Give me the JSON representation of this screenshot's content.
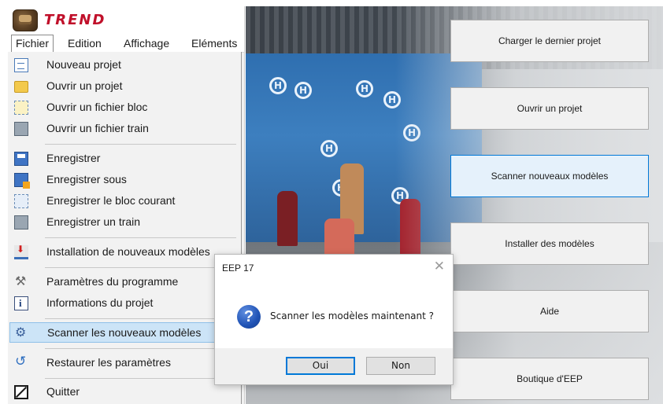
{
  "app": {
    "logo_text": "TREND"
  },
  "menubar": [
    "Fichier",
    "Edition",
    "Affichage",
    "Eléments"
  ],
  "menu": {
    "items": [
      {
        "label": "Nouveau projet",
        "icon": "new-document-icon"
      },
      {
        "label": "Ouvrir un projet",
        "icon": "folder-icon"
      },
      {
        "label": "Ouvrir un fichier bloc",
        "icon": "block-file-icon"
      },
      {
        "label": "Ouvrir un fichier train",
        "icon": "train-file-icon"
      },
      {
        "label": "Enregistrer",
        "icon": "save-icon"
      },
      {
        "label": "Enregistrer sous",
        "icon": "save-as-icon"
      },
      {
        "label": "Enregistrer le bloc courant",
        "icon": "save-block-icon"
      },
      {
        "label": "Enregistrer un train",
        "icon": "save-train-icon"
      },
      {
        "label": "Installation de nouveaux modèles",
        "icon": "install-icon"
      },
      {
        "label": "Paramètres du programme",
        "icon": "tools-icon"
      },
      {
        "label": "Informations du projet",
        "icon": "info-icon"
      },
      {
        "label": "Scanner les nouveaux modèles",
        "icon": "scan-icon",
        "highlighted": true
      },
      {
        "label": "Restaurer les paramètres",
        "icon": "restore-icon"
      },
      {
        "label": "Quitter",
        "icon": "quit-icon"
      }
    ]
  },
  "launcher": {
    "buttons": [
      "Charger le dernier projet",
      "Ouvrir un projet",
      "Scanner nouveaux modèles",
      "Installer des modèles",
      "Aide",
      "Boutique d'EEP"
    ]
  },
  "dialog": {
    "title": "EEP 17",
    "message": "Scanner les modèles maintenant ?",
    "yes": "Oui",
    "no": "Non"
  },
  "colors": {
    "menu_highlight": "#cce4f7",
    "logo_red": "#c0102a",
    "dialog_default_border": "#0078d7",
    "question_icon": "#1f52b5"
  }
}
